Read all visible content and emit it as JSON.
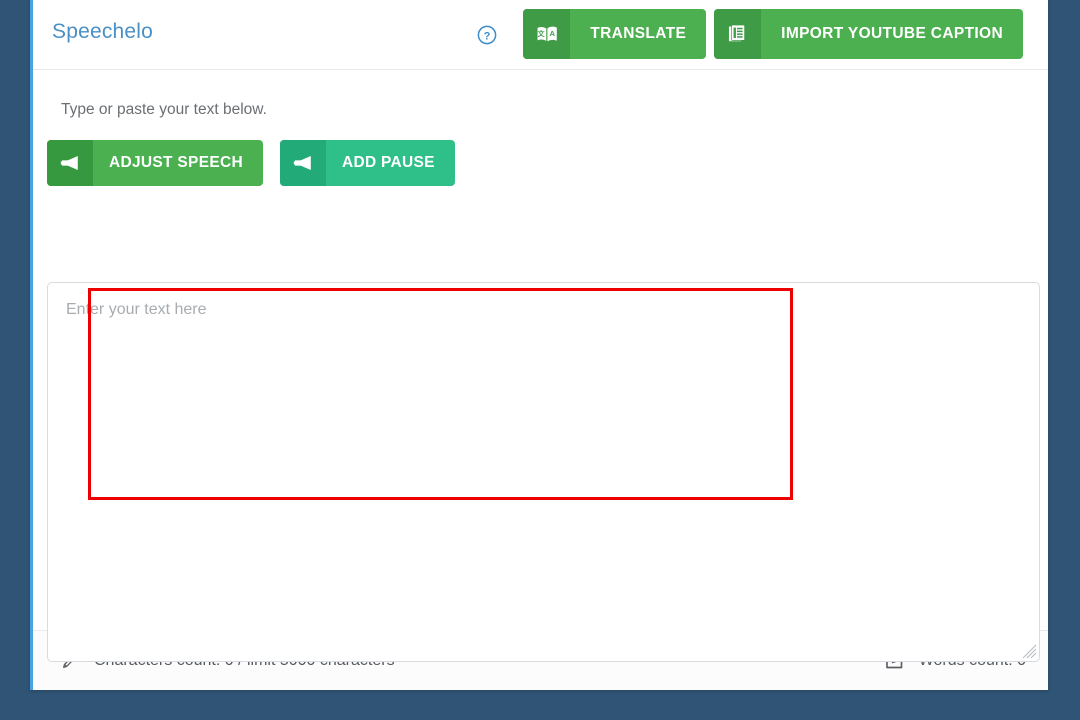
{
  "app": {
    "brand": "Speechelo",
    "background_color": "#2f5475",
    "accent_blue": "#4a90c4",
    "green": "#4caf50",
    "teal": "#2fc08a",
    "annotation_color": "#ee0000"
  },
  "header": {
    "help_icon": "question-circle-icon",
    "buttons": [
      {
        "label": "TRANSLATE",
        "icon": "translate-book-icon"
      },
      {
        "label": "IMPORT YOUTUBE CAPTION",
        "icon": "documents-icon"
      }
    ]
  },
  "main": {
    "hint": "Type or paste your text below.",
    "tools": [
      {
        "label": "ADJUST SPEECH",
        "icon": "megaphone-icon"
      },
      {
        "label": "ADD PAUSE",
        "icon": "megaphone-icon"
      }
    ],
    "editor": {
      "placeholder": "Enter your text here",
      "value": ""
    }
  },
  "footer": {
    "characters": {
      "icon": "pencil-icon",
      "text": "Characters count: 0 / limit 5000 characters",
      "count": 0,
      "limit": 5000
    },
    "words": {
      "icon": "edit-square-icon",
      "text": "Words count: 0",
      "count": 0
    }
  }
}
